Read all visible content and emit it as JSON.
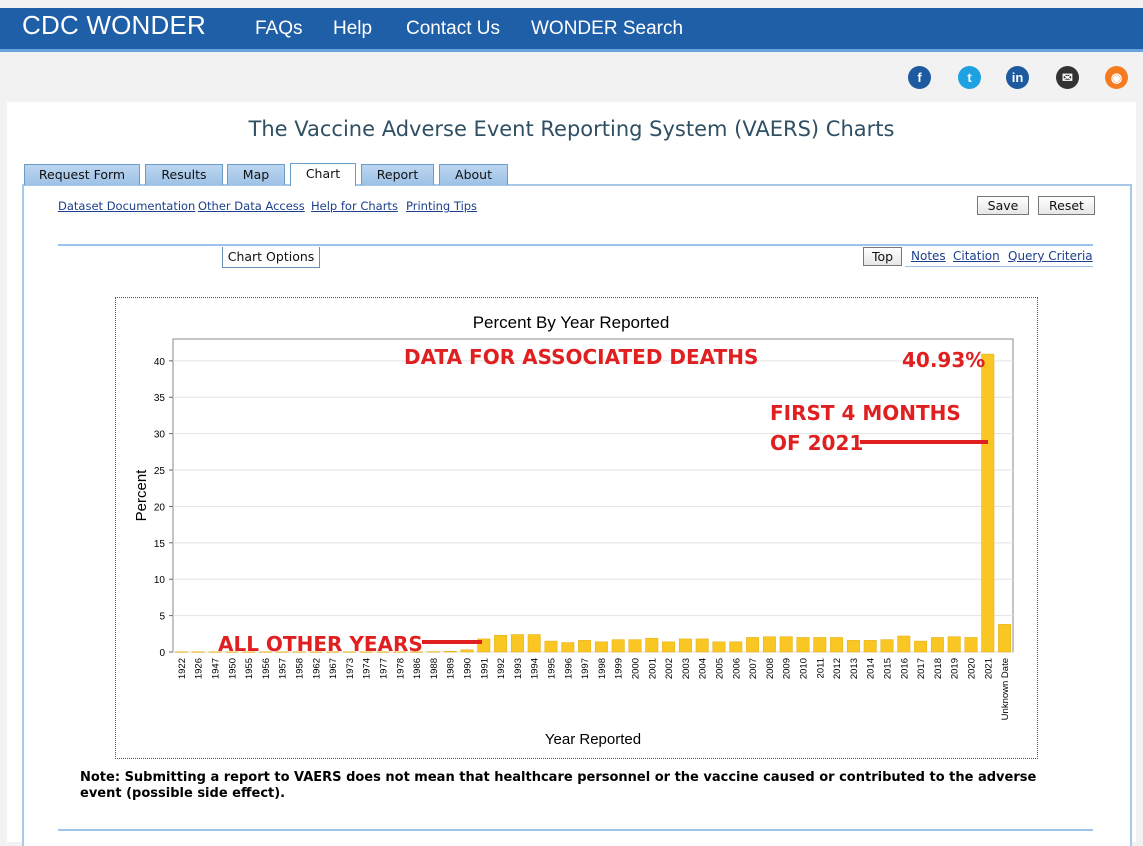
{
  "header": {
    "brand": "CDC WONDER",
    "nav": [
      "FAQs",
      "Help",
      "Contact Us",
      "WONDER Search"
    ]
  },
  "social": [
    {
      "icon": "facebook-icon",
      "glyph": "f",
      "color": "#1d5a9f"
    },
    {
      "icon": "twitter-icon",
      "glyph": "t",
      "color": "#1da1e2"
    },
    {
      "icon": "linkedin-icon",
      "glyph": "in",
      "color": "#1d5a9f"
    },
    {
      "icon": "email-icon",
      "glyph": "✉",
      "color": "#333333"
    },
    {
      "icon": "rss-icon",
      "glyph": "◉",
      "color": "#f47b20"
    }
  ],
  "page_title": "The Vaccine Adverse Event Reporting System (VAERS) Charts",
  "tabs": [
    "Request Form",
    "Results",
    "Map",
    "Chart",
    "Report",
    "About"
  ],
  "active_tab": "Chart",
  "links": [
    "Dataset Documentation",
    "Other Data Access",
    "Help for Charts",
    "Printing Tips"
  ],
  "buttons": {
    "save": "Save",
    "reset": "Reset",
    "chart_options": "Chart Options",
    "top": "Top"
  },
  "right_links": [
    "Notes",
    "Citation",
    "Query Criteria"
  ],
  "note": "Note: Submitting a report to VAERS does not mean that healthcare personnel or the vaccine caused or contributed to the adverse event (possible side effect).",
  "annotations": {
    "data_title": "DATA FOR ASSOCIATED DEATHS",
    "value_2021": "40.93%",
    "first_months_1": "FIRST 4 MONTHS",
    "first_months_2": "OF 2021",
    "all_other": "ALL OTHER YEARS",
    "color": "#e02020"
  },
  "chart_data": {
    "type": "bar",
    "title": "Percent By Year Reported",
    "xlabel": "Year Reported",
    "ylabel": "Percent",
    "ylim": [
      0,
      43
    ],
    "yticks": [
      0,
      5,
      10,
      15,
      20,
      25,
      30,
      35,
      40
    ],
    "grid": true,
    "bar_color": "#f9c623",
    "categories": [
      "1922",
      "1926",
      "1947",
      "1950",
      "1955",
      "1956",
      "1957",
      "1958",
      "1962",
      "1967",
      "1973",
      "1974",
      "1977",
      "1978",
      "1986",
      "1988",
      "1989",
      "1990",
      "1991",
      "1992",
      "1993",
      "1994",
      "1995",
      "1996",
      "1997",
      "1998",
      "1999",
      "2000",
      "2001",
      "2002",
      "2003",
      "2004",
      "2005",
      "2006",
      "2007",
      "2008",
      "2009",
      "2010",
      "2011",
      "2012",
      "2013",
      "2014",
      "2015",
      "2016",
      "2017",
      "2018",
      "2019",
      "2020",
      "2021",
      "Unknown Date"
    ],
    "values": [
      0.02,
      0.02,
      0.02,
      0.02,
      0.02,
      0.02,
      0.02,
      0.02,
      0.02,
      0.02,
      0.02,
      0.02,
      0.02,
      0.02,
      0.02,
      0.05,
      0.1,
      0.3,
      1.8,
      2.3,
      2.4,
      2.4,
      1.5,
      1.3,
      1.6,
      1.4,
      1.7,
      1.7,
      1.9,
      1.4,
      1.8,
      1.8,
      1.4,
      1.4,
      2.0,
      2.1,
      2.1,
      2.0,
      2.0,
      2.0,
      1.6,
      1.6,
      1.7,
      2.2,
      1.5,
      2.0,
      2.1,
      2.0,
      40.93,
      3.8
    ]
  }
}
